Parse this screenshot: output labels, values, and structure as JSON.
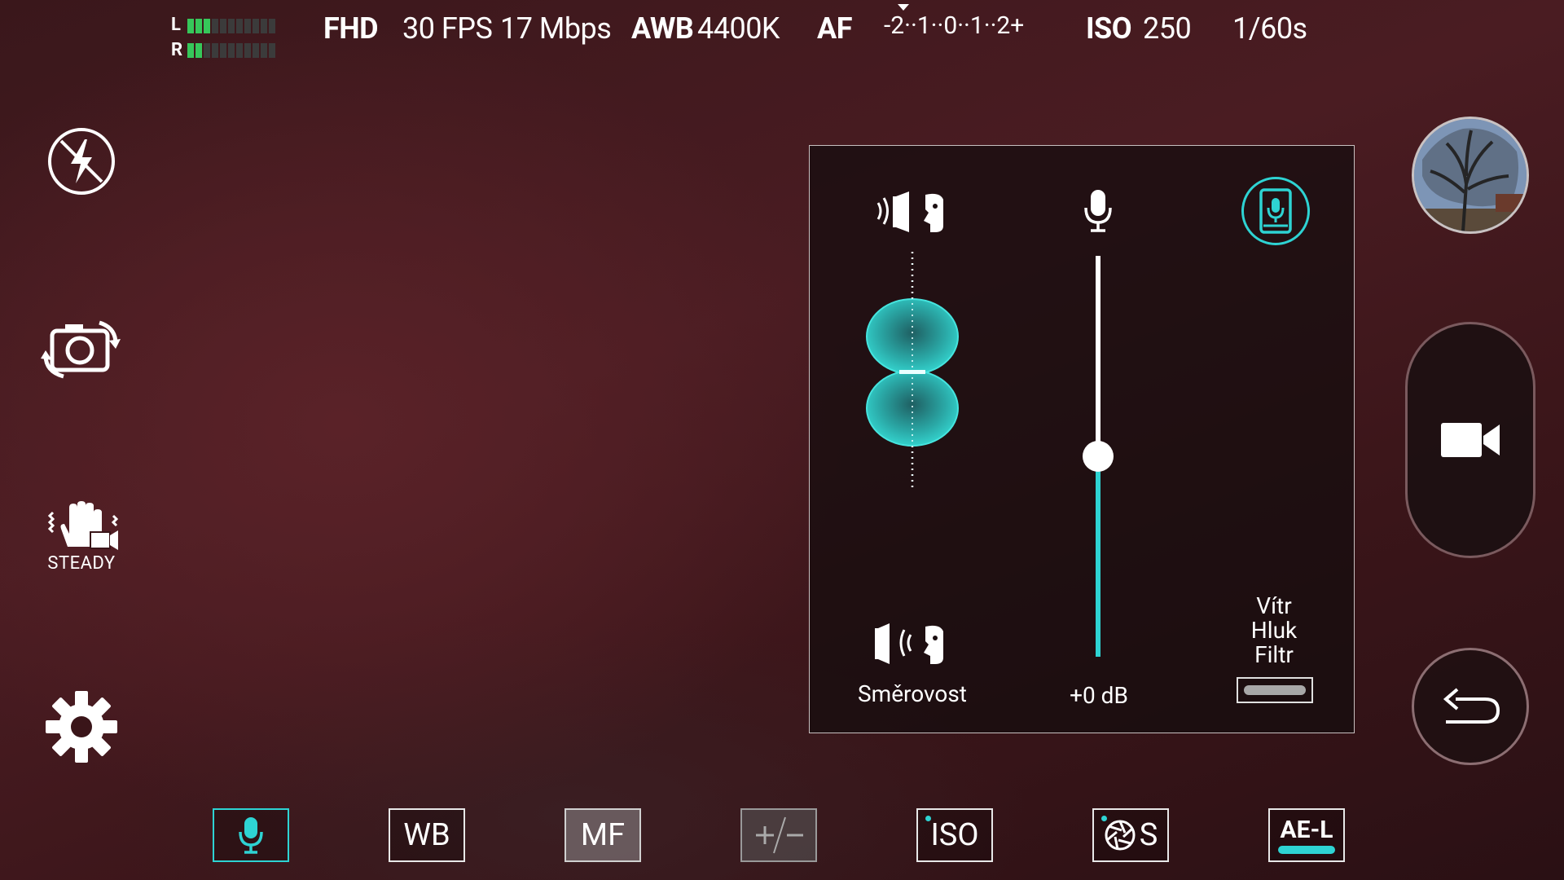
{
  "top_bar": {
    "meter": {
      "left_label": "L",
      "right_label": "R",
      "left_level_segments": 3,
      "right_level_segments": 2,
      "total_segments": 11
    },
    "resolution": "FHD",
    "fps": "30 FPS",
    "bitrate": "17 Mbps",
    "awb_label": "AWB",
    "awb_value": "4400K",
    "focus_mode": "AF",
    "ev_scale": "-2··1··0··1··2+",
    "iso_label": "ISO",
    "iso_value": "250",
    "shutter": "1/60s"
  },
  "left_column": {
    "flash_icon": "flash-off-icon",
    "switch_camera_icon": "camera-switch-icon",
    "steady_icon": "steady-hand-icon",
    "steady_label": "STEADY",
    "settings_icon": "gear-icon"
  },
  "audio_panel": {
    "directionality_label": "Směrovost",
    "gain_label": "+0 dB",
    "gain_level_fraction": 0.5,
    "wind_filter_label_line1": "Vítr",
    "wind_filter_label_line2": "Hluk",
    "wind_filter_label_line3": "Filtr",
    "wind_filter_on": false,
    "accent_color": "#2ed3d3"
  },
  "right_column": {
    "thumbnail_icon": "gallery-thumbnail",
    "record_icon": "video-camera-icon",
    "back_icon": "back-arrow-icon"
  },
  "bottom_toolbar": {
    "mic_icon": "microphone-icon",
    "wb_label": "WB",
    "mf_label": "MF",
    "exposure_icon": "plus-minus-icon",
    "iso_label": "ISO",
    "shutter_label": "S",
    "ael_label": "AE-L"
  }
}
